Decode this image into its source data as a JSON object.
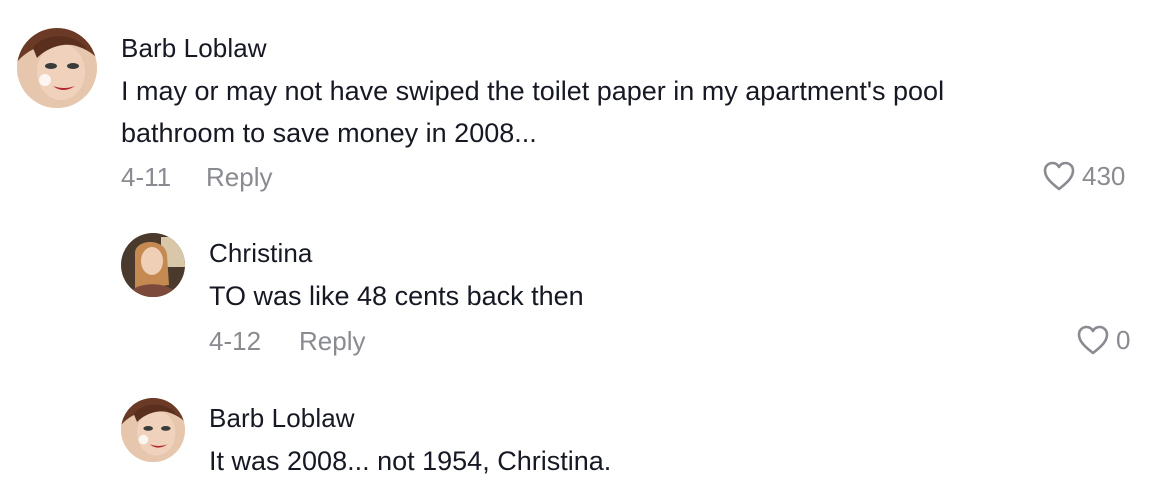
{
  "comments": [
    {
      "username": "Barb Loblaw",
      "text": "I may or may not have swiped the toilet paper in my apartment's pool bathroom to save money in 2008...",
      "date": "4-11",
      "reply_label": "Reply",
      "likes": "430",
      "avatar_icon": "barb-avatar"
    }
  ],
  "replies": [
    {
      "username": "Christina",
      "text": "TO was like 48 cents back then",
      "date": "4-12",
      "reply_label": "Reply",
      "likes": "0",
      "avatar_icon": "christina-avatar"
    },
    {
      "username": "Barb Loblaw",
      "text": "It was 2008... not 1954, Christina.",
      "avatar_icon": "barb-avatar"
    }
  ],
  "colors": {
    "text": "#161823",
    "muted": "#8a8b91",
    "background": "#ffffff"
  }
}
